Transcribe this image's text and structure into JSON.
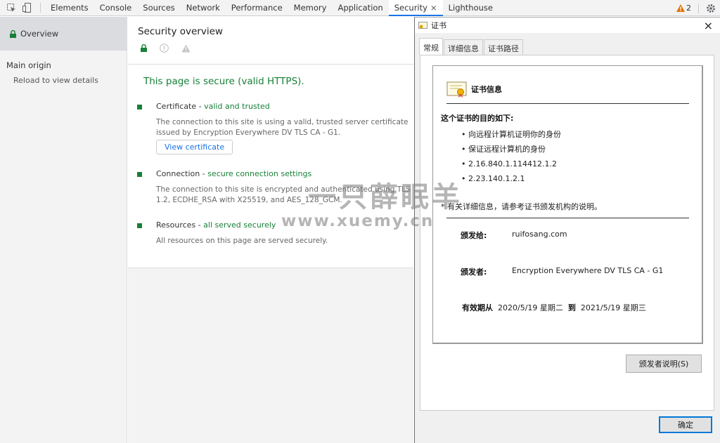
{
  "toolbar": {
    "tabs": [
      "Elements",
      "Console",
      "Sources",
      "Network",
      "Performance",
      "Memory",
      "Application",
      "Security",
      "Lighthouse"
    ],
    "active_tab": "Security",
    "close_glyph": "×",
    "warning_count": "2",
    "icons": [
      "inspect-icon",
      "device-icon",
      "warning-icon",
      "gear-icon"
    ]
  },
  "sidebar": {
    "overview": "Overview",
    "main_origin": "Main origin",
    "reload": "Reload to view details"
  },
  "main": {
    "title": "Security overview",
    "secure_text": "This page is secure (valid HTTPS).",
    "certificate": {
      "label": "Certificate - ",
      "status": "valid and trusted",
      "desc": "The connection to this site is using a valid, trusted server certificate issued by Encryption Everywhere DV TLS CA - G1.",
      "button": "View certificate"
    },
    "connection": {
      "label": "Connection - ",
      "status": "secure connection settings",
      "desc": "The connection to this site is encrypted and authenticated using TLS 1.2, ECDHE_RSA with X25519, and AES_128_GCM."
    },
    "resources": {
      "label": "Resources - ",
      "status": "all served securely",
      "desc": "All resources on this page are served securely."
    }
  },
  "dialog": {
    "title": "证书",
    "close": "×",
    "tabs": [
      "常规",
      "详细信息",
      "证书路径"
    ],
    "info_title": "证书信息",
    "purpose_title": "这个证书的目的如下:",
    "purposes": [
      "• 向远程计算机证明你的身份",
      "• 保证远程计算机的身份",
      "• 2.16.840.1.114412.1.2",
      "• 2.23.140.1.2.1"
    ],
    "note": "* 有关详细信息，请参考证书颁发机构的说明。",
    "issued_to_label": "颁发给:",
    "issued_to": "ruifosang.com",
    "issued_by_label": "颁发者:",
    "issued_by": "Encryption Everywhere DV TLS CA - G1",
    "validity_label": "有效期从",
    "valid_from": "2020/5/19 星期二",
    "to_label": "到",
    "valid_to": "2021/5/19 星期三",
    "issuer_statement_button": "颁发者说明(S)",
    "ok_button": "确定"
  },
  "watermark": {
    "line1": "一只薛眠羊",
    "line2": "www.xuemy.cn"
  },
  "colors": {
    "green": "#188038",
    "accent": "#1a73e8",
    "warning": "#e37400"
  }
}
